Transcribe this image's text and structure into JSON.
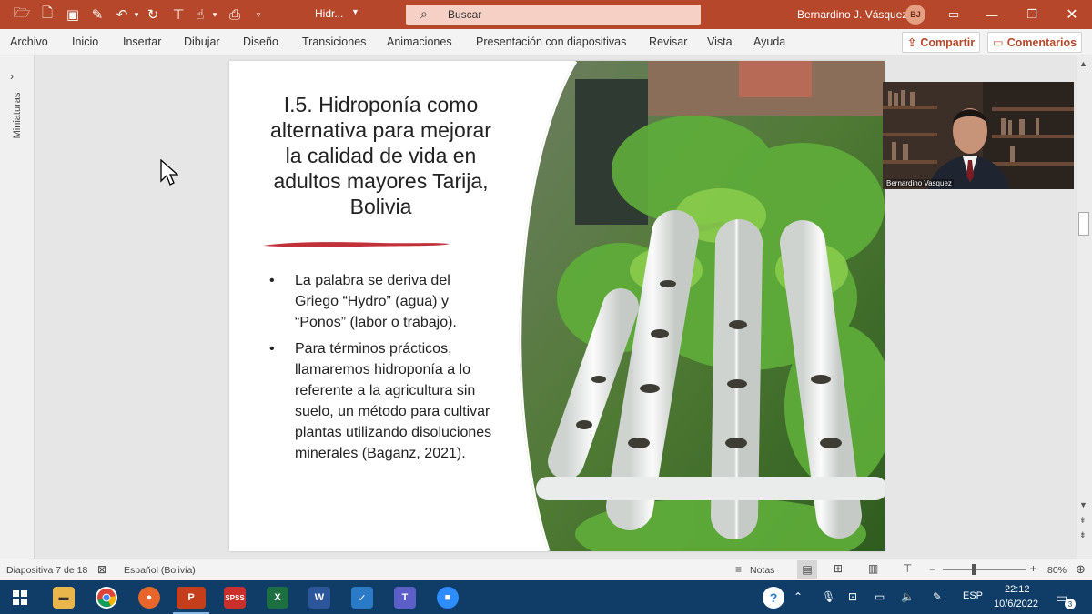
{
  "titlebar": {
    "doc_name": "Hidr...",
    "search_placeholder": "Buscar",
    "user_name": "Bernardino J. Vásquez",
    "user_initials": "BJ"
  },
  "ribbon": {
    "tabs": [
      "Archivo",
      "Inicio",
      "Insertar",
      "Dibujar",
      "Diseño",
      "Transiciones",
      "Animaciones",
      "Presentación con diapositivas",
      "Revisar",
      "Vista",
      "Ayuda"
    ],
    "share_label": "Compartir",
    "comments_label": "Comentarios"
  },
  "thumbnails_pane": {
    "label": "Miniaturas"
  },
  "slide": {
    "title": "I.5. Hidroponía como alternativa para mejorar la calidad de vida en adultos mayores Tarija, Bolivia",
    "bullets": [
      "La palabra se deriva del Griego “Hydro” (agua) y “Ponos” (labor o trabajo).",
      "Para términos prácticos, llamaremos hidroponía a lo referente a la agricultura sin suelo, un método para cultivar plantas utilizando disoluciones minerales (Baganz, 2021)."
    ]
  },
  "video": {
    "participant_name": "Bernardino Vasquez"
  },
  "statusbar": {
    "slide_info": "Diapositiva 7 de 18",
    "language": "Español (Bolivia)",
    "notes_label": "Notas",
    "zoom": "80%"
  },
  "taskbar": {
    "lang": "ESP",
    "time": "22:12",
    "date": "10/6/2022",
    "notification_count": "3"
  },
  "colors": {
    "accent": "#b7472a",
    "taskbar": "#0f3d68"
  }
}
